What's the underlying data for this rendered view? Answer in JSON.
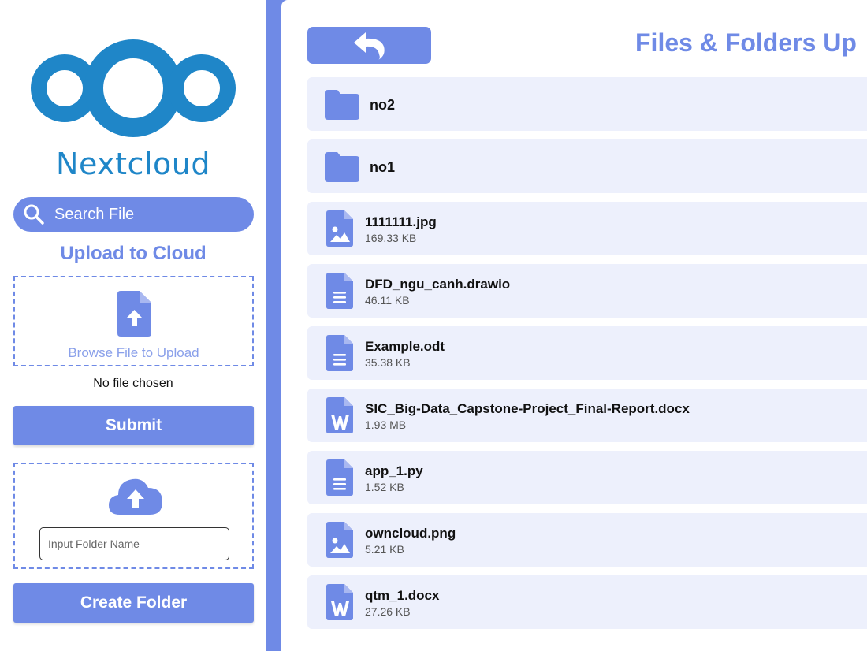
{
  "brand": {
    "name": "Nextcloud",
    "logo_color": "#1f86c8"
  },
  "theme": {
    "accent": "#6f8ae6",
    "row_bg": "#edf0fc"
  },
  "sidebar": {
    "search_placeholder": "Search File",
    "upload_title": "Upload to Cloud",
    "browse_label": "Browse File to Upload",
    "no_file_text": "No file chosen",
    "submit_label": "Submit",
    "folder_input_placeholder": "Input Folder Name",
    "create_folder_label": "Create Folder"
  },
  "main": {
    "back_icon": "back-arrow-icon",
    "title": "Files & Folders Up",
    "items": [
      {
        "name": "no2",
        "type": "folder",
        "icon": "folder-icon",
        "size": ""
      },
      {
        "name": "no1",
        "type": "folder",
        "icon": "folder-icon",
        "size": ""
      },
      {
        "name": "1111111.jpg",
        "type": "image",
        "icon": "image-file-icon",
        "size": "169.33 KB"
      },
      {
        "name": "DFD_ngu_canh.drawio",
        "type": "text",
        "icon": "document-file-icon",
        "size": "46.11 KB"
      },
      {
        "name": "Example.odt",
        "type": "text",
        "icon": "document-file-icon",
        "size": "35.38 KB"
      },
      {
        "name": "SIC_Big-Data_Capstone-Project_Final-Report.docx",
        "type": "word",
        "icon": "word-file-icon",
        "size": "1.93 MB"
      },
      {
        "name": "app_1.py",
        "type": "text",
        "icon": "document-file-icon",
        "size": "1.52 KB"
      },
      {
        "name": "owncloud.png",
        "type": "image",
        "icon": "image-file-icon",
        "size": "5.21 KB"
      },
      {
        "name": "qtm_1.docx",
        "type": "word",
        "icon": "word-file-icon",
        "size": "27.26 KB"
      }
    ]
  }
}
